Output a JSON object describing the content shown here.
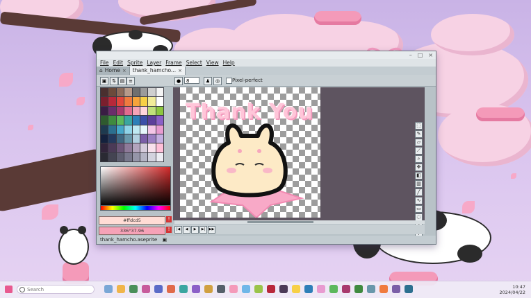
{
  "window": {
    "title": "",
    "controls": [
      "–",
      "□",
      "×"
    ]
  },
  "menu": [
    "File",
    "Edit",
    "Sprite",
    "Layer",
    "Frame",
    "Select",
    "View",
    "Help"
  ],
  "tabs": [
    {
      "label": "Home",
      "icon": "home-icon"
    },
    {
      "label": "thank_hamcho...",
      "icon": "file-icon"
    }
  ],
  "toolbar": {
    "brush_size": "8",
    "pixel_perfect_label": "Pixel-perfect"
  },
  "palette_colors": [
    "#4a2f2f",
    "#6b4a3b",
    "#8c6b5a",
    "#b69a8a",
    "#6f6f6f",
    "#9b9b9b",
    "#cfcfcf",
    "#f4f4f4",
    "#7a1f2e",
    "#b8283a",
    "#e0473c",
    "#f07b3e",
    "#f7a43b",
    "#f7d046",
    "#f2ec9a",
    "#ffffff",
    "#3a1d44",
    "#6a2d6b",
    "#a8396d",
    "#e16b8e",
    "#f5a3b6",
    "#ffd6dc",
    "#c0e07a",
    "#8cc63f",
    "#2f5a2f",
    "#3f8a3f",
    "#5cb85c",
    "#3aa6a0",
    "#2d7fb8",
    "#3b4fa8",
    "#5d3f9b",
    "#8b5fc7",
    "#1e3a4f",
    "#2c6f8f",
    "#46a7c9",
    "#8fd4e8",
    "#bfe9f2",
    "#e6f7fb",
    "#f4c6e7",
    "#e89bd0",
    "#14213d",
    "#23395d",
    "#406882",
    "#6998ab",
    "#b1d0e0",
    "#7b5ea7",
    "#9a7fc2",
    "#c3aee0",
    "#31243a",
    "#4b3a57",
    "#6b5577",
    "#8e7a99",
    "#b3a4bd",
    "#d6ccdc",
    "#f8e1ec",
    "#ffc0d8",
    "#2a2a33",
    "#444452",
    "#5e5e70",
    "#78788c",
    "#9595a8",
    "#b4b4c4",
    "#d3d3de",
    "#ececf2"
  ],
  "colors": {
    "fg_hex": "#ffdcd5",
    "fg_label": "#ffdcd5",
    "bg_label": "336°37.96"
  },
  "canvas": {
    "art_text": "Thank You"
  },
  "status": {
    "filename": "thank_hamcho.aseprite"
  },
  "taskbar": {
    "search_placeholder": "Search",
    "time": "10:47",
    "date": "2024/04/22"
  }
}
